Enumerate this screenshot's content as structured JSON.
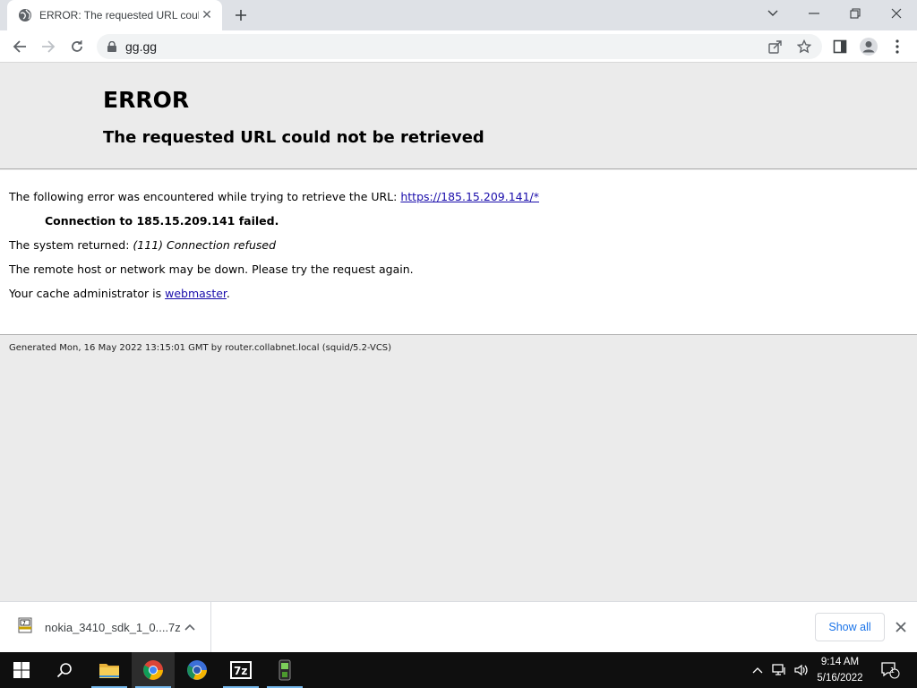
{
  "browser": {
    "tab_title": "ERROR: The requested URL could not be retrieved",
    "address": "gg.gg"
  },
  "page": {
    "heading": "ERROR",
    "subheading": "The requested URL could not be retrieved",
    "line1_prefix": "The following error was encountered while trying to retrieve the URL: ",
    "line1_link": "https://185.15.209.141/*",
    "line2": "Connection to 185.15.209.141 failed.",
    "line3_prefix": "The system returned: ",
    "line3_error": "(111) Connection refused",
    "line4": "The remote host or network may be down. Please try the request again.",
    "line5_prefix": "Your cache administrator is ",
    "line5_link": "webmaster",
    "line5_suffix": ".",
    "footer": "Generated Mon, 16 May 2022 13:15:01 GMT by router.collabnet.local (squid/5.2-VCS)"
  },
  "downloads": {
    "file_name": "nokia_3410_sdk_1_0....7z",
    "show_all_label": "Show all"
  },
  "taskbar": {
    "time": "9:14 AM",
    "date": "5/16/2022",
    "notification_count": "1"
  },
  "icons": {
    "favicon": "globe-icon",
    "back": "back-arrow-icon",
    "forward": "forward-arrow-icon",
    "reload": "reload-icon",
    "lock": "lock-icon",
    "share": "share-icon",
    "bookmark": "star-icon",
    "side_panel": "side-panel-icon",
    "profile": "profile-icon",
    "menu": "kebab-menu-icon"
  },
  "colors": {
    "link": "#1a0dab",
    "show_all": "#1a73e8",
    "taskbar": "#0f0f0f"
  }
}
